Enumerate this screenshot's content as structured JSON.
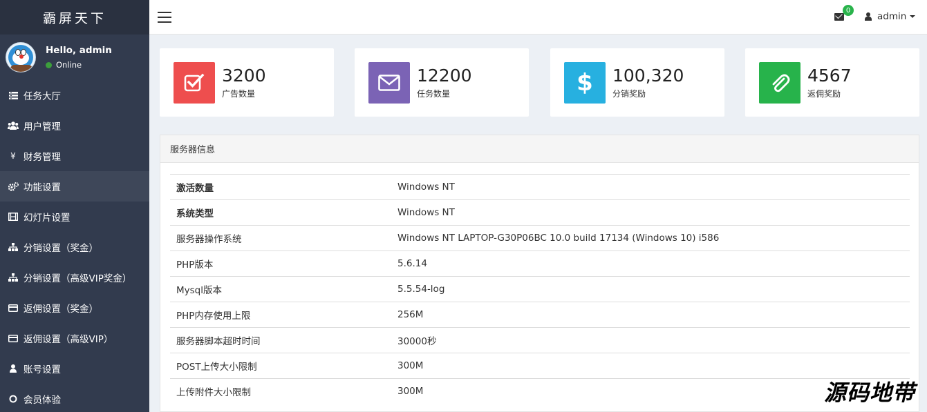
{
  "brand": "霸屏天下",
  "user": {
    "greeting": "Hello, admin",
    "status": "Online"
  },
  "menu": [
    {
      "label": "任务大厅",
      "icon": "list-icon"
    },
    {
      "label": "用户管理",
      "icon": "users-icon"
    },
    {
      "label": "财务管理",
      "icon": "yen-icon"
    },
    {
      "label": "功能设置",
      "icon": "cogs-icon"
    },
    {
      "label": "幻灯片设置",
      "icon": "film-icon"
    },
    {
      "label": "分销设置（奖金）",
      "icon": "sitemap-icon"
    },
    {
      "label": "分销设置（高级VIP奖金）",
      "icon": "sitemap-icon"
    },
    {
      "label": "返佣设置（奖金）",
      "icon": "credit-card-icon"
    },
    {
      "label": "返佣设置（高级VIP）",
      "icon": "credit-card-icon"
    },
    {
      "label": "账号设置",
      "icon": "user-icon"
    },
    {
      "label": "会员体验",
      "icon": "circle-icon"
    }
  ],
  "topbar": {
    "mail_count": "0",
    "username": "admin"
  },
  "stats": [
    {
      "value": "3200",
      "label": "广告数量",
      "color": "#ee4e4e",
      "icon": "check-square-icon"
    },
    {
      "value": "12200",
      "label": "任务数量",
      "color": "#7b63b5",
      "icon": "envelope-icon"
    },
    {
      "value": "100,320",
      "label": "分销奖励",
      "color": "#27b0e0",
      "icon": "dollar-icon"
    },
    {
      "value": "4567",
      "label": "返佣奖励",
      "color": "#27b34b",
      "icon": "paperclip-icon"
    }
  ],
  "server_panel": {
    "title": "服务器信息",
    "rows": [
      {
        "key": "激活数量",
        "value": "Windows NT"
      },
      {
        "key": "系统类型",
        "value": "Windows NT"
      },
      {
        "key": "服务器操作系统",
        "value": "Windows NT LAPTOP-G30P06BC 10.0 build 17134 (Windows 10) i586"
      },
      {
        "key": "PHP版本",
        "value": "5.6.14"
      },
      {
        "key": "Mysql版本",
        "value": "5.5.54-log"
      },
      {
        "key": "PHP内存使用上限",
        "value": "256M"
      },
      {
        "key": "服务器脚本超时时间",
        "value": "30000秒"
      },
      {
        "key": "POST上传大小限制",
        "value": "300M"
      },
      {
        "key": "上传附件大小限制",
        "value": "300M"
      }
    ]
  },
  "watermark": "源码地带"
}
